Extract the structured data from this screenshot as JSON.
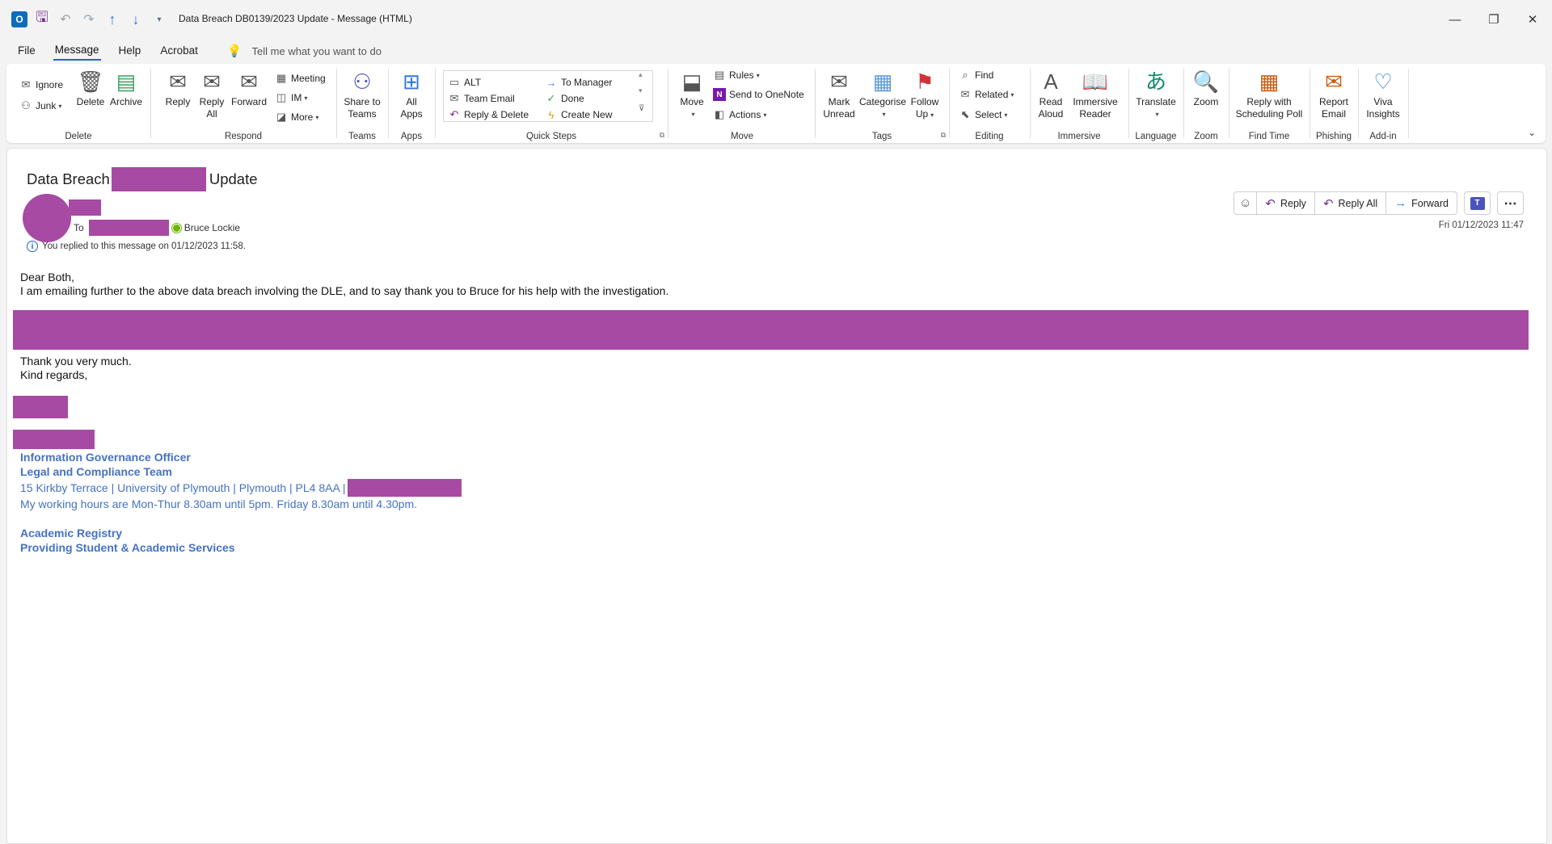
{
  "titlebar": {
    "title": "Data Breach DB0139/2023 Update  -  Message (HTML)",
    "app_icon": "O",
    "window_controls": [
      "—",
      "❐",
      "✕"
    ]
  },
  "menu": {
    "tabs": [
      "File",
      "Message",
      "Help",
      "Acrobat"
    ],
    "active": "Message",
    "tell_me_placeholder": "Tell me what you want to do"
  },
  "ribbon": {
    "delete": {
      "label": "Delete",
      "ignore": "Ignore",
      "junk": "Junk",
      "delete": "Delete",
      "archive": "Archive"
    },
    "respond": {
      "label": "Respond",
      "reply": "Reply",
      "reply_all_1": "Reply",
      "reply_all_2": "All",
      "forward": "Forward",
      "meeting": "Meeting",
      "im": "IM",
      "more": "More"
    },
    "teams": {
      "label": "Teams",
      "share_1": "Share to",
      "share_2": "Teams"
    },
    "apps": {
      "label": "Apps",
      "all_1": "All",
      "all_2": "Apps"
    },
    "quick_steps": {
      "label": "Quick Steps",
      "items": [
        "ALT",
        "Team Email",
        "Reply & Delete",
        "To Manager",
        "Done",
        "Create New"
      ]
    },
    "move": {
      "label": "Move",
      "move": "Move",
      "rules": "Rules",
      "onenote": "Send to OneNote",
      "actions": "Actions"
    },
    "tags": {
      "label": "Tags",
      "mark_1": "Mark",
      "mark_2": "Unread",
      "categorise": "Categorise",
      "follow_1": "Follow",
      "follow_2": "Up"
    },
    "editing": {
      "label": "Editing",
      "find": "Find",
      "related": "Related",
      "select": "Select"
    },
    "immersive": {
      "label": "Immersive",
      "read_1": "Read",
      "read_2": "Aloud",
      "imm_1": "Immersive",
      "imm_2": "Reader"
    },
    "language": {
      "label": "Language",
      "translate": "Translate"
    },
    "zoom": {
      "label": "Zoom",
      "zoom": "Zoom"
    },
    "find_time": {
      "label": "Find Time",
      "poll_1": "Reply with",
      "poll_2": "Scheduling Poll"
    },
    "phishing": {
      "label": "Phishing",
      "report_1": "Report",
      "report_2": "Email"
    },
    "addin": {
      "label": "Add-in",
      "viva_1": "Viva",
      "viva_2": "Insights"
    }
  },
  "message": {
    "subject_prefix": "Data Breach",
    "subject_suffix": "Update",
    "to_label": "To",
    "recipient": "Bruce Lockie",
    "replied_info": "You replied to this message on 01/12/2023 11:58.",
    "date": "Fri 01/12/2023 11:47",
    "actions": {
      "reply": "Reply",
      "reply_all": "Reply All",
      "forward": "Forward"
    },
    "body": {
      "greeting": "Dear Both,",
      "line1": "I am emailing further to the above data breach involving the DLE, and to say thank you to Bruce for his help with the investigation.",
      "thanks": "Thank you very much.",
      "regards": "Kind regards,"
    },
    "signature": {
      "role": "Information Governance Officer",
      "team": "Legal and Compliance Team",
      "address": "15 Kirkby Terrace | University of Plymouth | Plymouth | PL4 8AA |",
      "hours": "My working hours are Mon-Thur 8.30am until 5pm. Friday 8.30am until 4.30pm.",
      "dept": "Academic Registry",
      "dept_sub": "Providing Student & Academic Services"
    }
  },
  "colors": {
    "redaction": "#a64aa3",
    "signature": "#4472c4",
    "accent": "#2563c9"
  }
}
